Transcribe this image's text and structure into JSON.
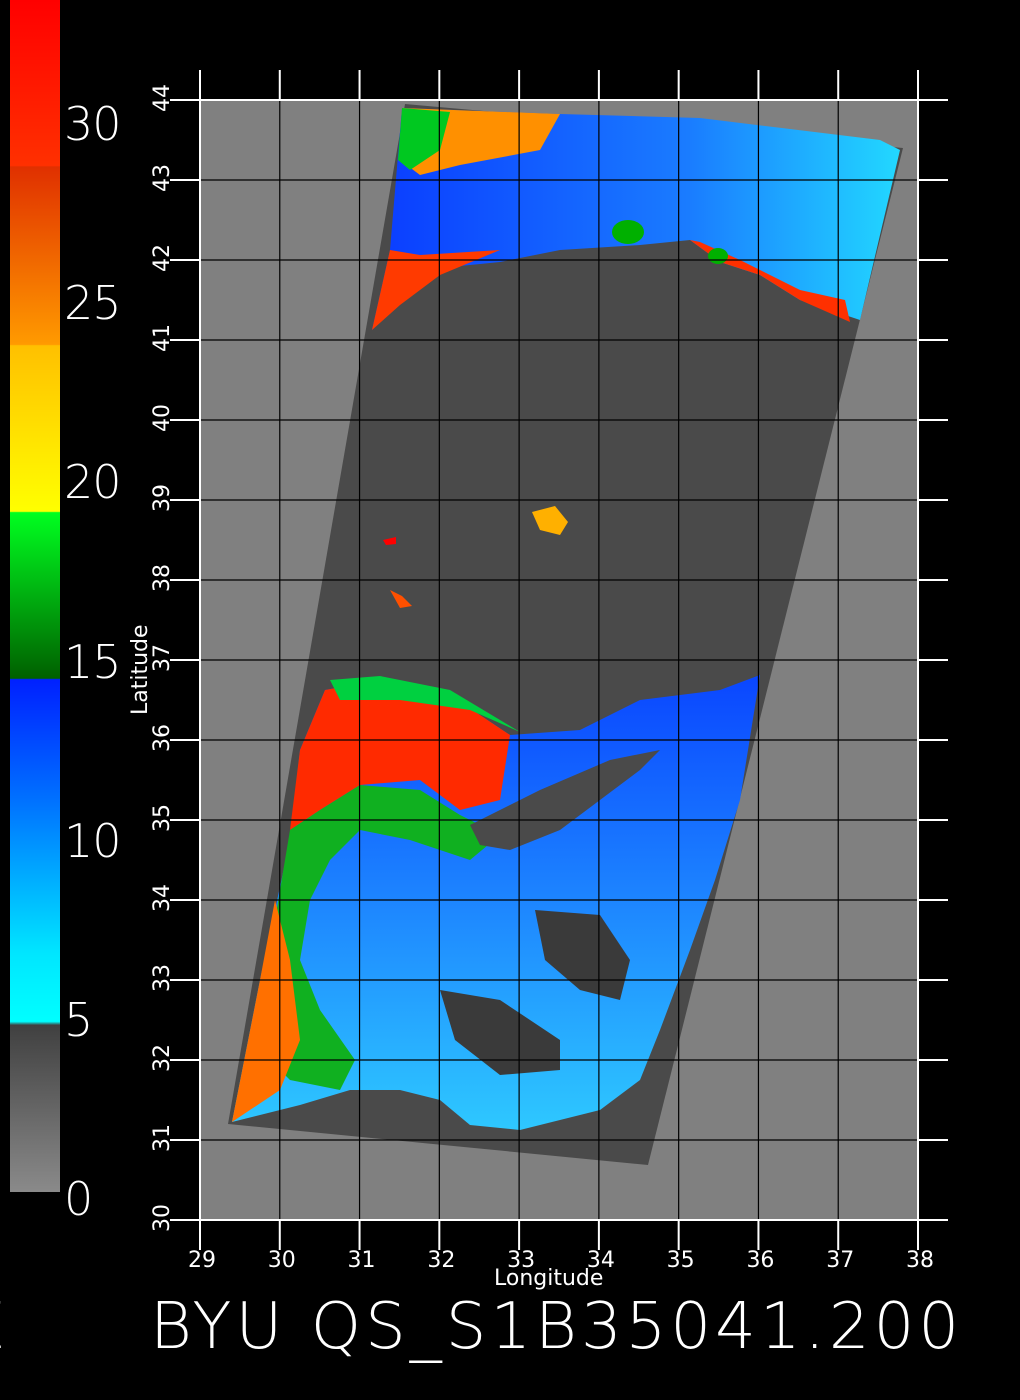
{
  "colorbar": {
    "ticks": [
      "30",
      "25",
      "20",
      "15",
      "10",
      "5",
      "0"
    ],
    "stops": [
      {
        "label": "0-5",
        "color": "#707070"
      },
      {
        "label": "5-10",
        "color": "#00ffff"
      },
      {
        "label": "10-15",
        "color": "#0030ff"
      },
      {
        "label": "15-20",
        "color": "#00ff20"
      },
      {
        "label": "20-25",
        "color": "#ffee00"
      },
      {
        "label": "25-30",
        "color": "#ff5500"
      },
      {
        "label": "30+",
        "color": "#ff1a00"
      }
    ]
  },
  "map": {
    "latitude_label": "Latitude",
    "longitude_label": "Longitude",
    "lat_ticks": [
      "30",
      "31",
      "32",
      "33",
      "34",
      "35",
      "36",
      "37",
      "38",
      "39",
      "40",
      "41",
      "42",
      "43",
      "44"
    ],
    "lon_ticks": [
      "29",
      "30",
      "31",
      "32",
      "33",
      "34",
      "35",
      "36",
      "37",
      "38"
    ],
    "lat_range": [
      30,
      44
    ],
    "lon_range": [
      29,
      38
    ],
    "land_color": "#808080",
    "swath_land_color": "#4a4a4a"
  },
  "footer": {
    "left_fragment": "E",
    "title": "BYU  QS_S1B35041.200"
  }
}
